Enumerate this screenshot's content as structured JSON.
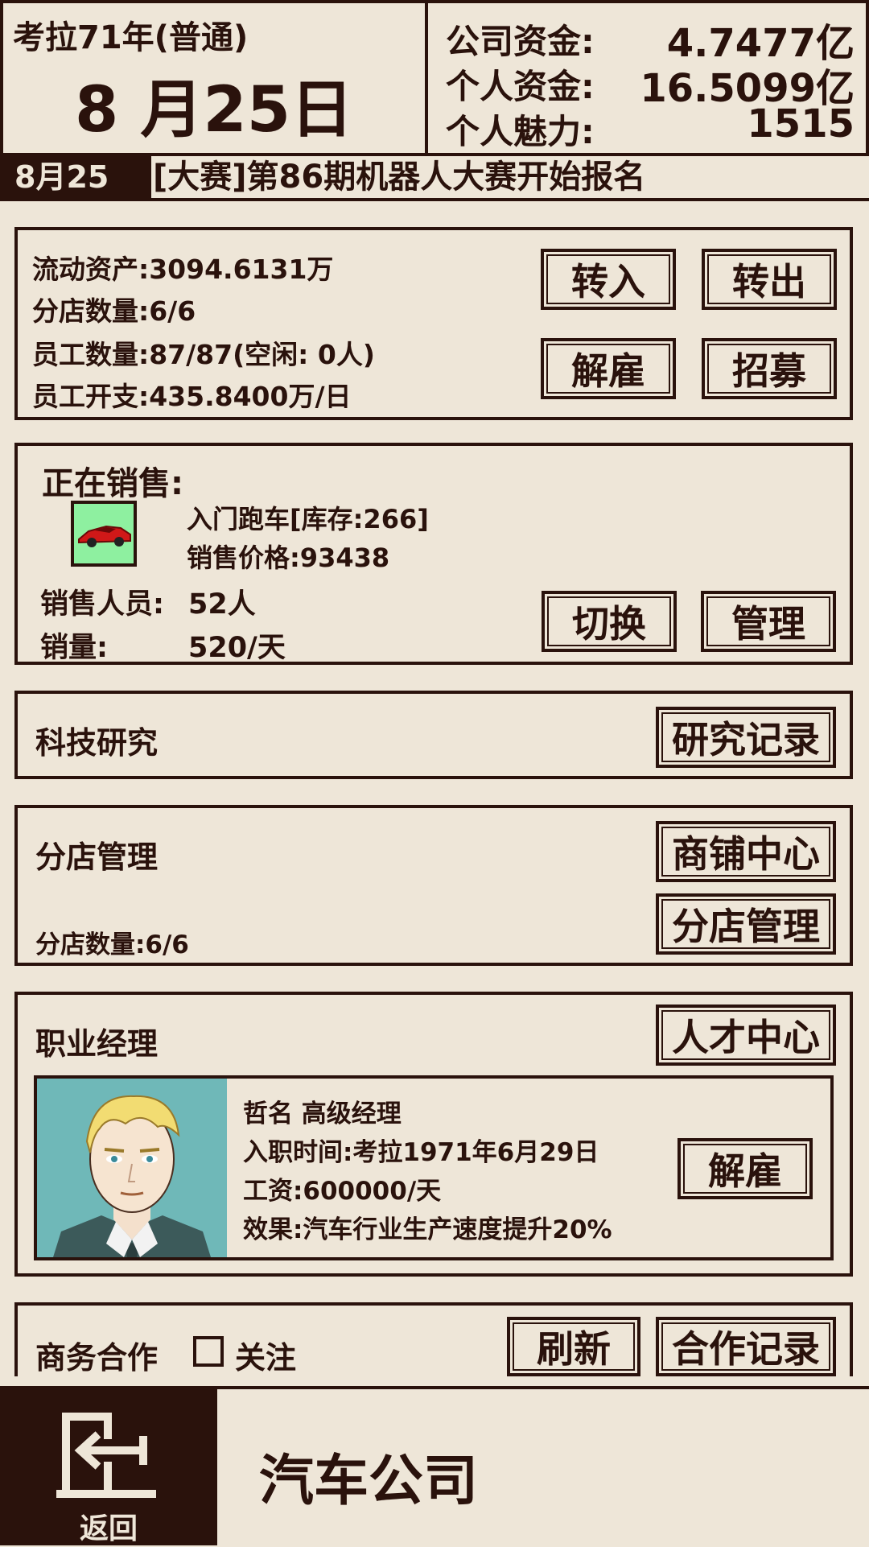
{
  "header": {
    "year_label": "考拉71年(普通)",
    "date_label": "8 月25日",
    "company_funds_label": "公司资金:",
    "company_funds_value": "4.7477亿",
    "personal_funds_label": "个人资金:",
    "personal_funds_value": "16.5099亿",
    "charm_label": "个人魅力:",
    "charm_value": "1515"
  },
  "news": {
    "date": "8月25日:",
    "text": "[大赛]第86期机器人大赛开始报名"
  },
  "finance": {
    "current_assets": "流动资产:3094.6131万",
    "branch_count": "分店数量:6/6",
    "staff_count": "员工数量:87/87(空闲: 0人)",
    "staff_cost": "员工开支:435.8400万/日",
    "transfer_in": "转入",
    "transfer_out": "转出",
    "fire": "解雇",
    "recruit": "招募"
  },
  "sales": {
    "title": "正在销售:",
    "product_name": "入门跑车[库存:266]",
    "price": "销售价格:93438",
    "staff_label": "销售人员:",
    "staff_value": "52人",
    "volume_label": "销量:",
    "volume_value": "520/天",
    "switch": "切换",
    "manage": "管理",
    "product_icon": "red-sports-car-icon"
  },
  "research": {
    "title": "科技研究",
    "records": "研究记录"
  },
  "branches": {
    "title": "分店管理",
    "count": "分店数量:6/6",
    "shop_center": "商铺中心",
    "branch_manage": "分店管理"
  },
  "manager": {
    "title": "职业经理",
    "talent_center": "人才中心",
    "name_rank": "哲名 高级经理",
    "hire_date": "入职时间:考拉1971年6月29日",
    "salary": "工资:600000/天",
    "effect": "效果:汽车行业生产速度提升20%",
    "fire": "解雇"
  },
  "business": {
    "title": "商务合作",
    "follow_label": "关注",
    "follow_checked": false,
    "refresh": "刷新",
    "records": "合作记录"
  },
  "footer": {
    "back_label": "返回",
    "page_title": "汽车公司",
    "back_icon": "exit-door-icon"
  },
  "colors": {
    "background": "#eee6d8",
    "ink": "#2a120c",
    "product_bg": "#8ef0a0",
    "portrait_bg": "#6fb8b8"
  }
}
